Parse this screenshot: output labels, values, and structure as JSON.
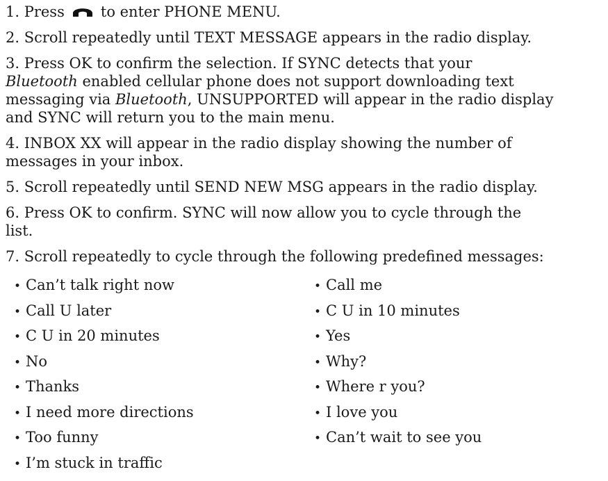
{
  "steps": [
    {
      "parts": [
        {
          "text": "1. Press"
        },
        {
          "icon": "phone-handset-icon"
        },
        {
          "text": "to enter PHONE MENU."
        }
      ]
    },
    {
      "parts": [
        {
          "text": "2. Scroll repeatedly until TEXT MESSAGE appears in the radio display."
        }
      ]
    },
    {
      "parts": [
        {
          "text": "3. Press OK to confirm the selection. If SYNC detects that your"
        },
        {
          "br": true
        },
        {
          "text": "Bluetooth",
          "italic": true
        },
        {
          "text": " enabled cellular phone does not support downloading text"
        },
        {
          "br": true
        },
        {
          "text": "messaging via "
        },
        {
          "text": "Bluetooth",
          "italic": true
        },
        {
          "text": ", UNSUPPORTED will appear in the radio display"
        },
        {
          "br": true
        },
        {
          "text": "and SYNC will return you to the main menu."
        }
      ]
    },
    {
      "parts": [
        {
          "text": "4. INBOX XX will appear in the radio display showing the number of"
        },
        {
          "br": true
        },
        {
          "text": "messages in your inbox."
        }
      ]
    },
    {
      "parts": [
        {
          "text": "5. Scroll repeatedly until SEND NEW MSG appears in the radio display."
        }
      ]
    },
    {
      "parts": [
        {
          "text": "6. Press OK to confirm. SYNC will now allow you to cycle through the"
        },
        {
          "br": true
        },
        {
          "text": "list."
        }
      ]
    },
    {
      "parts": [
        {
          "text": "7. Scroll repeatedly to cycle through the following predefined messages:"
        }
      ]
    }
  ],
  "bullet_glyph": "•",
  "messages_left": [
    "Can’t talk right now",
    "Call U later",
    "C U in 20 minutes",
    "No",
    "Thanks",
    "I need more directions",
    "Too funny",
    "I’m stuck in traffic"
  ],
  "messages_right": [
    "Call me",
    "C U in 10 minutes",
    "Yes",
    "Why?",
    "Where r you?",
    "I love you",
    "Can’t wait to see you"
  ]
}
